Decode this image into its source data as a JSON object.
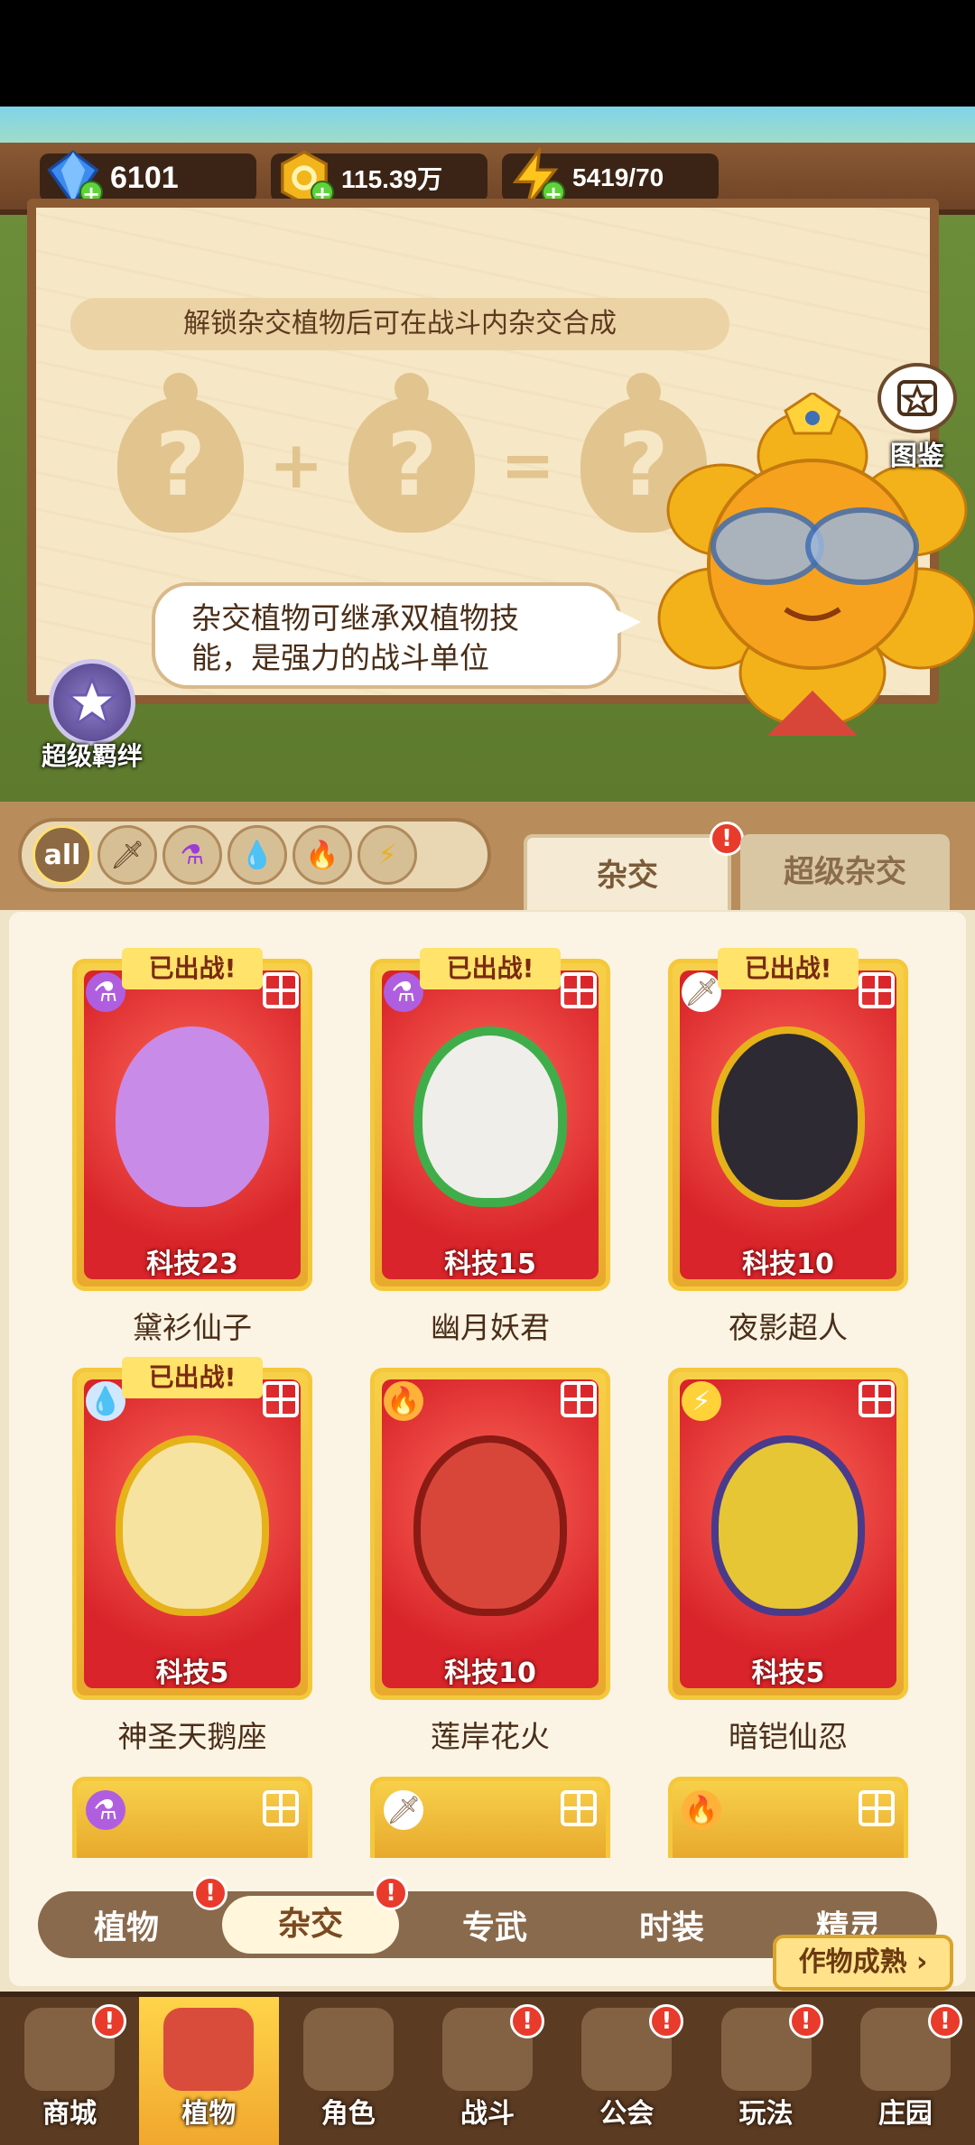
{
  "resources": {
    "gems": "6101",
    "coins": "115.39万",
    "energy": "5419/70"
  },
  "board": {
    "hint": "解锁杂交植物后可在战斗内杂交合成",
    "speech_line1": "杂交植物可继承双植物技",
    "speech_line2": "能，是强力的战斗单位",
    "atlas_label": "图鉴",
    "bond_label": "超级羁绊"
  },
  "filters": {
    "all_label": "all",
    "icons": [
      "sword-icon",
      "potion-icon",
      "water-drop-icon",
      "fire-icon",
      "lightning-icon"
    ]
  },
  "tabs": {
    "cross": "杂交",
    "super_cross": "超级杂交"
  },
  "deployed_label": "已出战!",
  "cards": [
    {
      "name": "黛衫仙子",
      "tech": "科技23",
      "deployed": true,
      "element": "potion",
      "color": "#c98be8"
    },
    {
      "name": "幽月妖君",
      "tech": "科技15",
      "deployed": true,
      "element": "potion",
      "color": "#f0eeea"
    },
    {
      "name": "夜影超人",
      "tech": "科技10",
      "deployed": true,
      "element": "sword",
      "color": "#2e2a33"
    },
    {
      "name": "神圣天鹅座",
      "tech": "科技5",
      "deployed": true,
      "element": "water",
      "color": "#f7e3a0"
    },
    {
      "name": "莲岸花火",
      "tech": "科技10",
      "deployed": false,
      "element": "fire",
      "color": "#d8463a"
    },
    {
      "name": "暗铠仙忍",
      "tech": "科技5",
      "deployed": false,
      "element": "lightning",
      "color": "#e6c635"
    }
  ],
  "subnav": {
    "items": [
      "植物",
      "杂交",
      "专武",
      "时装",
      "精灵"
    ],
    "active": "杂交",
    "harvest": "作物成熟"
  },
  "bottom_nav": {
    "items": [
      "商城",
      "植物",
      "角色",
      "战斗",
      "公会",
      "玩法",
      "庄园"
    ],
    "active": "植物"
  }
}
